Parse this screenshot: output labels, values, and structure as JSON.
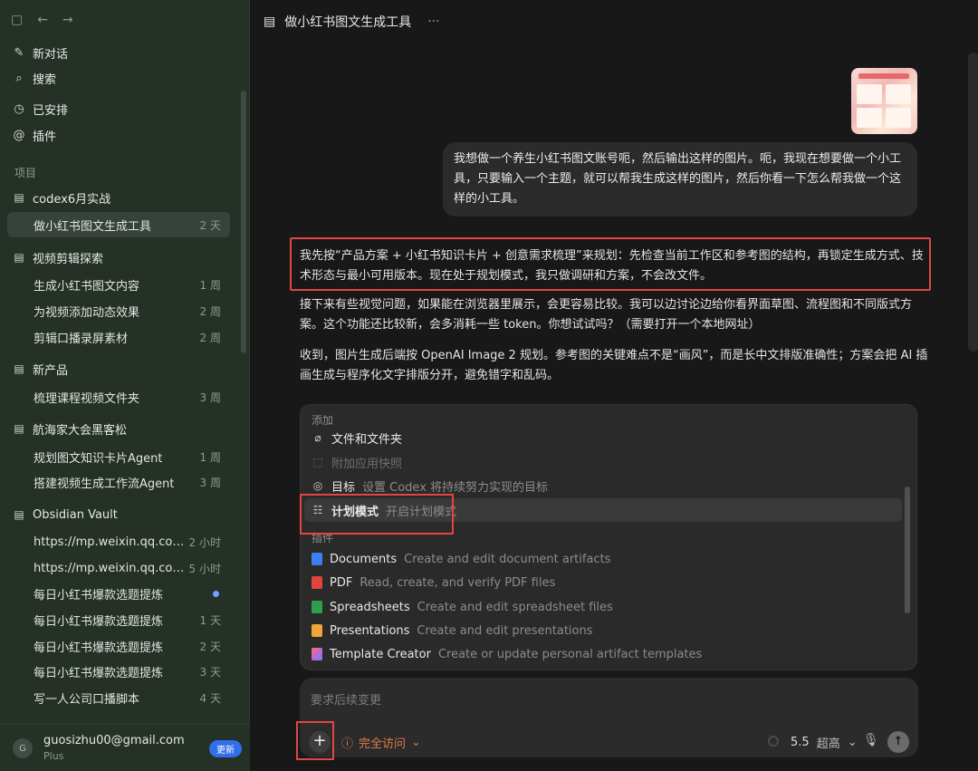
{
  "sidebar": {
    "nav": [
      {
        "icon": "compose-icon",
        "glyph": "✎",
        "label": "新对话"
      },
      {
        "icon": "search-icon",
        "glyph": "⌕",
        "label": "搜索"
      },
      {
        "icon": "clock-icon",
        "glyph": "◷",
        "label": "已安排"
      },
      {
        "icon": "at-icon",
        "glyph": "@",
        "label": "插件"
      }
    ],
    "section_label": "项目",
    "projects": [
      {
        "name": "codex6月实战",
        "threads": [
          {
            "title": "做小红书图文生成工具",
            "age": "2 天",
            "active": true
          }
        ]
      },
      {
        "name": "视频剪辑探索",
        "threads": [
          {
            "title": "生成小红书图文内容",
            "age": "1 周"
          },
          {
            "title": "为视频添加动态效果",
            "age": "2 周"
          },
          {
            "title": "剪辑口播录屏素材",
            "age": "2 周"
          }
        ]
      },
      {
        "name": "新产品",
        "threads": [
          {
            "title": "梳理课程视频文件夹",
            "age": "3 周"
          }
        ]
      },
      {
        "name": "航海家大会黑客松",
        "threads": [
          {
            "title": "规划图文知识卡片Agent",
            "age": "1 周"
          },
          {
            "title": "搭建视频生成工作流Agent",
            "age": "3 周"
          }
        ]
      },
      {
        "name": "Obsidian Vault",
        "threads": [
          {
            "title": "https://mp.weixin.qq.com/...",
            "age": "2 小时"
          },
          {
            "title": "https://mp.weixin.qq.com/...",
            "age": "5 小时"
          },
          {
            "title": "每日小红书爆款选题提炼",
            "age": "",
            "unread": true
          },
          {
            "title": "每日小红书爆款选题提炼",
            "age": "1 天"
          },
          {
            "title": "每日小红书爆款选题提炼",
            "age": "2 天"
          },
          {
            "title": "每日小红书爆款选题提炼",
            "age": "3 天"
          },
          {
            "title": "写一人公司口播脚本",
            "age": "4 天"
          }
        ]
      }
    ],
    "account": {
      "avatar_letter": "G",
      "email": "guosizhu00@gmail.com",
      "plan": "Plus",
      "update_label": "更新"
    }
  },
  "main": {
    "title": "做小红书图文生成工具",
    "more": "···",
    "user_message": "我想做一个养生小红书图文账号呃，然后输出这样的图片。呃，我现在想要做一个小工具，只要输入一个主题，就可以帮我生成这样的图片，然后你看一下怎么帮我做一个这样的小工具。",
    "assistant": [
      "我先按“产品方案 + 小红书知识卡片 + 创意需求梳理”来规划：先检查当前工作区和参考图的结构，再锁定生成方式、技术形态与最小可用版本。现在处于规划模式，我只做调研和方案，不会改文件。",
      "接下来有些视觉问题，如果能在浏览器里展示，会更容易比较。我可以边讨论边给你看界面草图、流程图和不同版式方案。这个功能还比较新，会多消耗一些 token。你想试试吗？（需要打开一个本地网址）",
      "收到，图片生成后端按 OpenAI Image 2 规划。参考图的关键难点不是“画风”，而是长中文排版准确性；方案会把 AI 插画生成与程序化文字排版分开，避免错字和乱码。"
    ]
  },
  "menu": {
    "header": "添加",
    "items": [
      {
        "icon": "paperclip-icon",
        "glyph": "⌀",
        "label": "文件和文件夹",
        "desc": "",
        "dim": false
      },
      {
        "icon": "screenshot-icon",
        "glyph": "⬚",
        "label": "附加应用快照",
        "desc": "",
        "dim": true
      },
      {
        "icon": "target-icon",
        "glyph": "◎",
        "label": "目标",
        "desc": "设置 Codex 将持续努力实现的目标",
        "dim": false
      },
      {
        "icon": "checklist-icon",
        "glyph": "☷",
        "label": "计划模式",
        "desc": "开启计划模式",
        "dim": false,
        "selected": true
      }
    ],
    "plugins_label": "插件",
    "plugins": [
      {
        "icon": "documents-icon",
        "color": "#3b7ff2",
        "label": "Documents",
        "desc": "Create and edit document artifacts"
      },
      {
        "icon": "pdf-icon",
        "color": "#e0443c",
        "label": "PDF",
        "desc": "Read, create, and verify PDF files"
      },
      {
        "icon": "spreadsheets-icon",
        "color": "#2f9e4f",
        "label": "Spreadsheets",
        "desc": "Create and edit spreadsheet files"
      },
      {
        "icon": "presentations-icon",
        "color": "#f0a43a",
        "label": "Presentations",
        "desc": "Create and edit presentations"
      },
      {
        "icon": "template-creator-icon",
        "color": "#c566d6",
        "label": "Template Creator",
        "desc": "Create or update personal artifact templates"
      }
    ]
  },
  "composer": {
    "placeholder": "要求后续变更",
    "plus": "+",
    "access_label": "完全访问",
    "model": "5.5",
    "quality": "超高",
    "send": "↑"
  },
  "colors": {
    "accent_red": "#e04646",
    "access_orange": "#e07b47",
    "blue": "#2f6fea"
  }
}
